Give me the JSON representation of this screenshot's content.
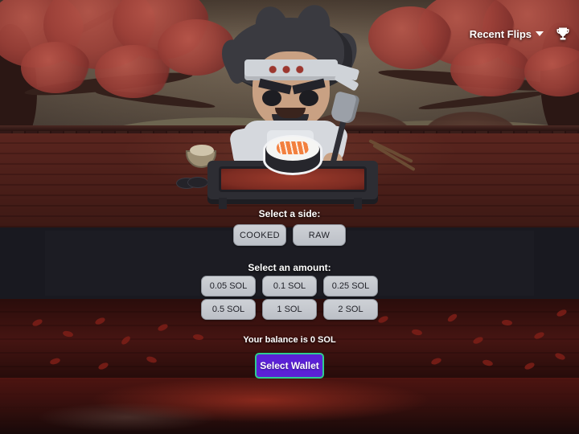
{
  "header": {
    "recent_flips_label": "Recent Flips",
    "caret_icon": "chevron-down-icon",
    "trophy_icon": "trophy-icon"
  },
  "side_section": {
    "label": "Select a side:",
    "options": [
      {
        "label": "COOKED"
      },
      {
        "label": "RAW"
      }
    ]
  },
  "amount_section": {
    "label": "Select an amount:",
    "options": [
      {
        "label": "0.05 SOL"
      },
      {
        "label": "0.1 SOL"
      },
      {
        "label": "0.25 SOL"
      },
      {
        "label": "0.5 SOL"
      },
      {
        "label": "1 SOL"
      },
      {
        "label": "2 SOL"
      }
    ]
  },
  "wallet_section": {
    "balance_text": "Your balance is 0 SOL",
    "button_label": "Select Wallet",
    "button_color": "#5b21d6",
    "button_border_color": "#2ecc8f"
  },
  "scene": {
    "character": "sushi-chef",
    "coin": "sushi-nigiri-coin",
    "background": "cherry-blossom-restaurant"
  }
}
